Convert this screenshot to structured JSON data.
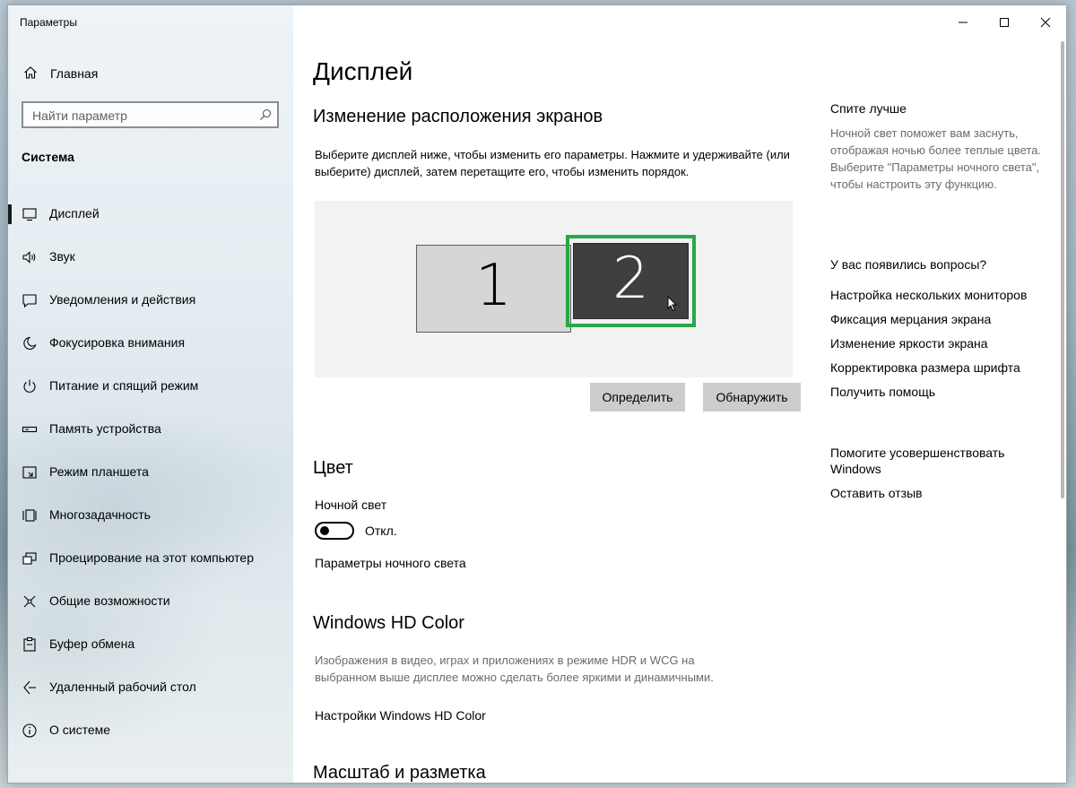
{
  "window": {
    "title": "Параметры"
  },
  "sidebar": {
    "home_label": "Главная",
    "search_placeholder": "Найти параметр",
    "section_label": "Система",
    "items": [
      {
        "label": "Дисплей",
        "icon": "monitor-icon",
        "active": true
      },
      {
        "label": "Звук",
        "icon": "speaker-icon"
      },
      {
        "label": "Уведомления и действия",
        "icon": "notification-icon"
      },
      {
        "label": "Фокусировка внимания",
        "icon": "moon-icon"
      },
      {
        "label": "Питание и спящий режим",
        "icon": "power-icon"
      },
      {
        "label": "Память устройства",
        "icon": "storage-icon"
      },
      {
        "label": "Режим планшета",
        "icon": "tablet-icon"
      },
      {
        "label": "Многозадачность",
        "icon": "multitask-icon"
      },
      {
        "label": "Проецирование на этот компьютер",
        "icon": "project-icon"
      },
      {
        "label": "Общие возможности",
        "icon": "shared-icon"
      },
      {
        "label": "Буфер обмена",
        "icon": "clipboard-icon"
      },
      {
        "label": "Удаленный рабочий стол",
        "icon": "remote-desktop-icon"
      },
      {
        "label": "О системе",
        "icon": "info-icon"
      }
    ]
  },
  "main": {
    "page_title": "Дисплей",
    "arrange": {
      "heading": "Изменение расположения экранов",
      "description": "Выберите дисплей ниже, чтобы изменить его параметры. Нажмите и удерживайте (или выберите) дисплей, затем перетащите его, чтобы изменить порядок.",
      "monitor1": "1",
      "monitor2": "2",
      "identify_button": "Определить",
      "detect_button": "Обнаружить"
    },
    "color": {
      "heading": "Цвет",
      "night_light_label": "Ночной свет",
      "toggle_state": "Откл.",
      "night_light_settings_link": "Параметры ночного света"
    },
    "hdr": {
      "heading": "Windows HD Color",
      "description": "Изображения в видео, играх и приложениях в режиме HDR и WCG на выбранном выше дисплее можно сделать более яркими и динамичными.",
      "settings_link": "Настройки Windows HD Color"
    },
    "scale": {
      "heading": "Масштаб и разметка"
    }
  },
  "aside": {
    "sleep_heading": "Спите лучше",
    "sleep_text": "Ночной свет поможет вам заснуть, отображая ночью более теплые цвета. Выберите \"Параметры ночного света\", чтобы настроить эту функцию.",
    "questions_heading": "У вас появились вопросы?",
    "links": [
      "Настройка нескольких мониторов",
      "Фиксация мерцания экрана",
      "Изменение яркости экрана",
      "Корректировка размера шрифта",
      "Получить помощь"
    ],
    "improve_heading": "Помогите усовершенствовать Windows",
    "feedback_link": "Оставить отзыв"
  },
  "colors": {
    "accent_green": "#27a84a",
    "button_gray": "#cccccc",
    "selected_monitor": "#3f3f3f"
  }
}
